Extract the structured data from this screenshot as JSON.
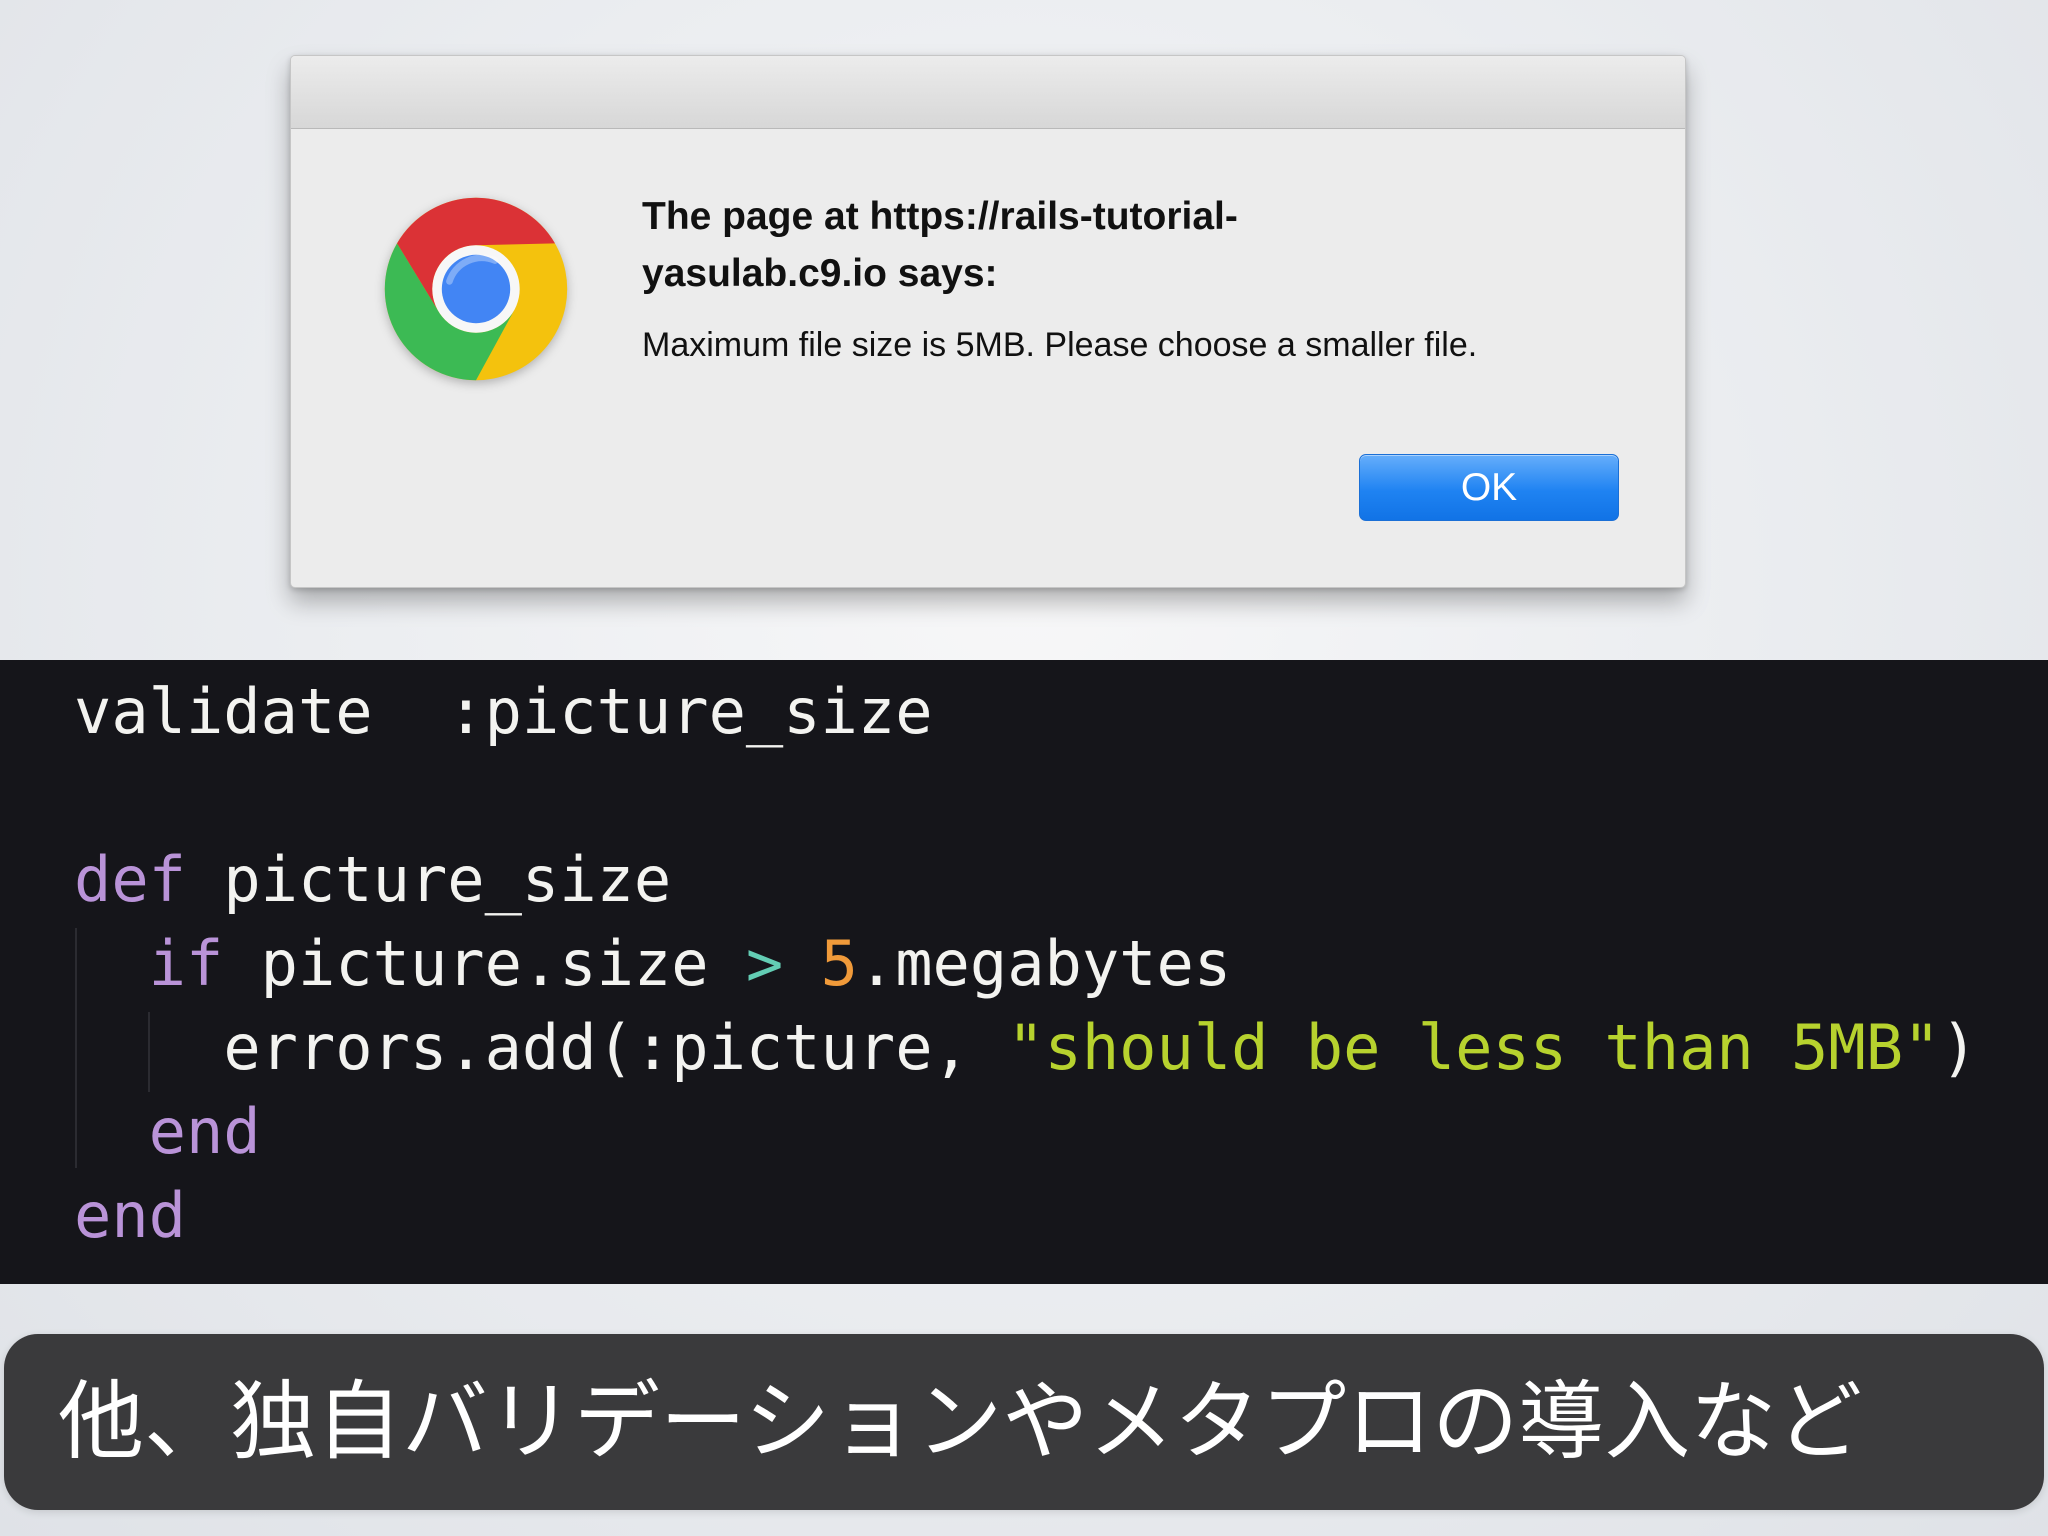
{
  "dialog": {
    "title": "The page at https://rails-tutorial-yasulab.c9.io says:",
    "message": "Maximum file size is 5MB. Please choose a smaller file.",
    "ok_label": "OK",
    "icon": "chrome-icon"
  },
  "code": {
    "line1": {
      "method": "validate",
      "symbol": ":picture_size"
    },
    "line2": {
      "keyword": "def",
      "name": "picture_size"
    },
    "line3": {
      "keyword": "if",
      "expression": "picture.size",
      "operator": ">",
      "number": "5",
      "method": ".megabytes"
    },
    "line4": {
      "call": "errors.add(:picture, ",
      "string": "\"should be less than 5MB\"",
      "close": ")"
    },
    "line5": {
      "keyword": "end"
    },
    "line6": {
      "keyword": "end"
    }
  },
  "caption": {
    "text": "他、独自バリデーションやメタプロの導入など"
  },
  "colors": {
    "keyword": "#b993d8",
    "operator": "#63cdb4",
    "number": "#f09a3a",
    "string": "#b7d22e",
    "button": "#1f83f2"
  }
}
